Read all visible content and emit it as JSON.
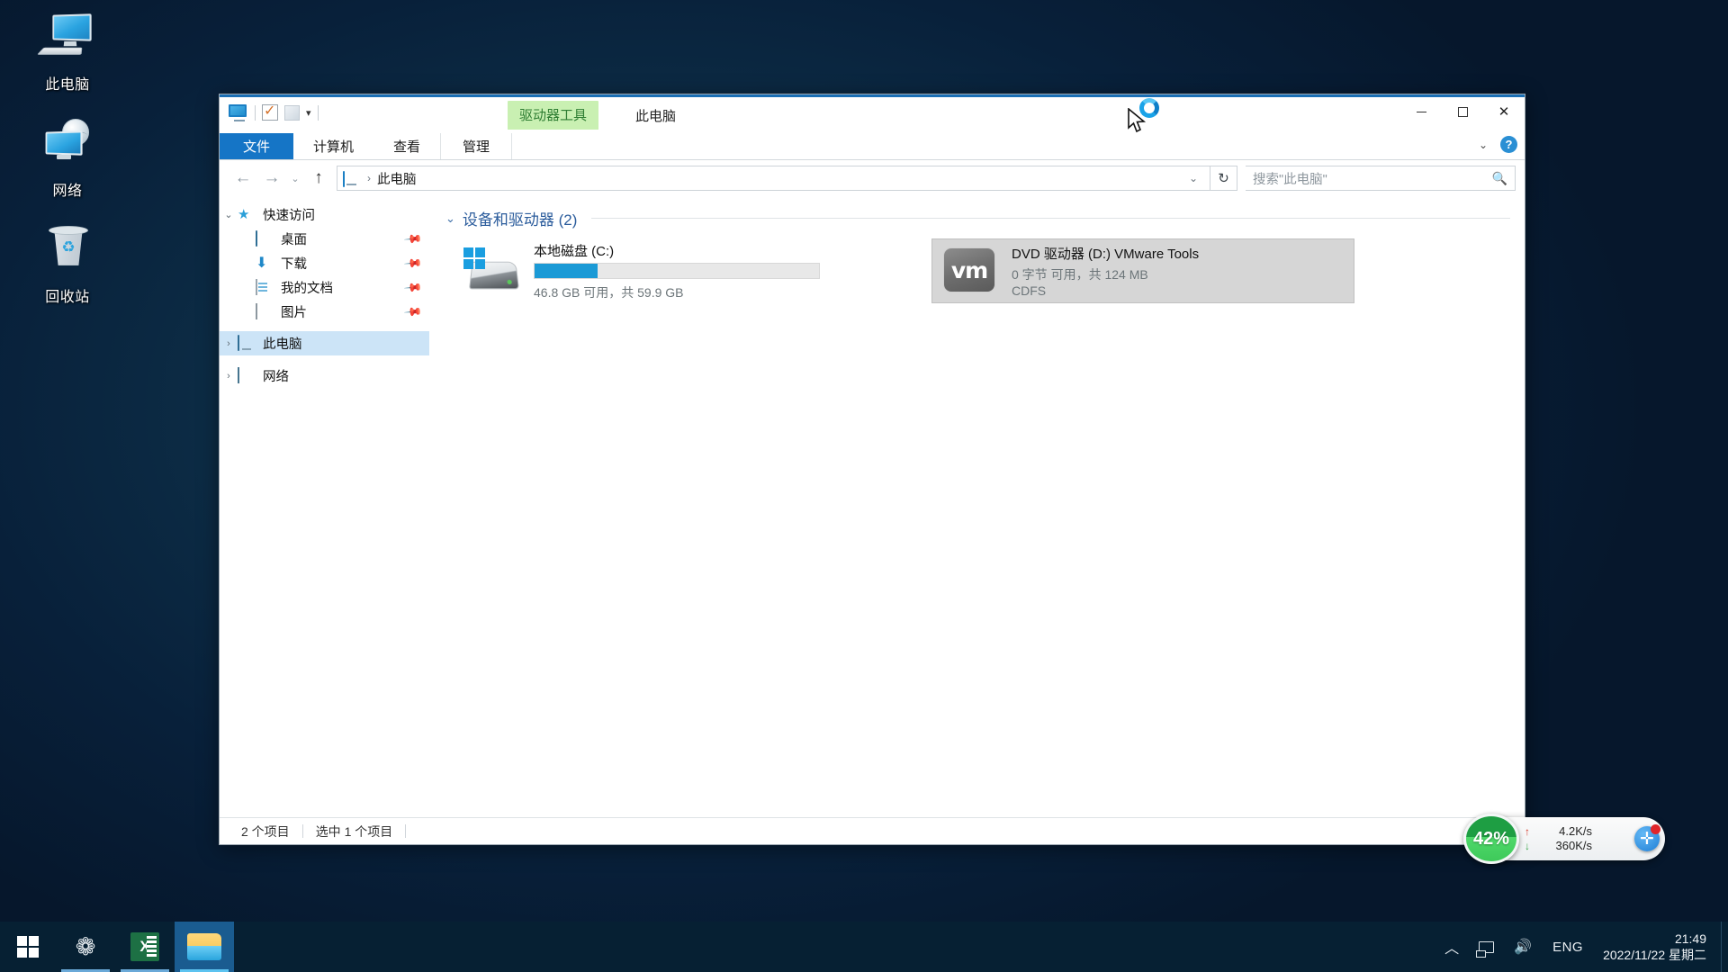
{
  "desktop": {
    "icons": [
      {
        "label": "此电脑",
        "icon": "this-pc-icon"
      },
      {
        "label": "网络",
        "icon": "network-icon"
      },
      {
        "label": "回收站",
        "icon": "recycle-bin-icon"
      }
    ]
  },
  "window": {
    "title": "此电脑",
    "contextual_tab": "驱动器工具",
    "quick_access_toolbar": [
      {
        "name": "this-pc-icon",
        "label": "此电脑"
      },
      {
        "name": "properties-icon",
        "label": "属性"
      },
      {
        "name": "new-folder-icon",
        "label": "新建文件夹"
      },
      {
        "name": "customize-qat-caret",
        "label": "▾"
      }
    ],
    "controls": {
      "minimize": "—",
      "maximize": "□",
      "close": "✕",
      "ribbon_collapse": "⌄",
      "help": "?"
    },
    "ribbon_tabs": [
      {
        "label": "文件",
        "active": true
      },
      {
        "label": "计算机",
        "active": false
      },
      {
        "label": "查看",
        "active": false
      },
      {
        "label": "管理",
        "active": false
      }
    ]
  },
  "addressbar": {
    "back": "←",
    "forward": "→",
    "history": "⌄",
    "up": "↑",
    "crumb_icon": "this-pc-icon",
    "separator": "›",
    "path": "此电脑",
    "dropdown": "⌄",
    "refresh": "↻"
  },
  "search": {
    "placeholder": "搜索\"此电脑\"",
    "icon": "search-icon"
  },
  "navpane": {
    "items": [
      {
        "label": "快速访问",
        "level": 1,
        "expander": "⌄",
        "icon": "pin-star-icon",
        "pinned": false,
        "selected": false
      },
      {
        "label": "桌面",
        "level": 2,
        "expander": "",
        "icon": "desktop-icon",
        "pinned": true,
        "selected": false
      },
      {
        "label": "下载",
        "level": 2,
        "expander": "",
        "icon": "downloads-icon",
        "pinned": true,
        "selected": false
      },
      {
        "label": "我的文档",
        "level": 2,
        "expander": "",
        "icon": "documents-icon",
        "pinned": true,
        "selected": false
      },
      {
        "label": "图片",
        "level": 2,
        "expander": "",
        "icon": "pictures-icon",
        "pinned": true,
        "selected": false
      },
      {
        "label": "此电脑",
        "level": 1,
        "expander": "›",
        "icon": "this-pc-icon",
        "pinned": false,
        "selected": true
      },
      {
        "label": "网络",
        "level": 1,
        "expander": "›",
        "icon": "network-icon",
        "pinned": false,
        "selected": false
      }
    ],
    "pin_glyph": "📌"
  },
  "content": {
    "group": {
      "chevron": "⌄",
      "title": "设备和驱动器 (2)"
    },
    "drives": [
      {
        "name": "本地磁盘 (C:)",
        "free_text": "46.8 GB 可用，共 59.9 GB",
        "fill_percent": 22,
        "bar_color": "#1b9ad6",
        "icon": "hard-drive-windows-icon",
        "selected": false,
        "fs": ""
      },
      {
        "name": "DVD 驱动器 (D:) VMware Tools",
        "free_text": "0 字节 可用，共 124 MB",
        "fs": "CDFS",
        "icon": "vmware-disc-icon",
        "icon_text": "vm",
        "selected": true,
        "fill_percent": 0
      }
    ]
  },
  "statusbar": {
    "item_count": "2 个项目",
    "selection": "选中 1 个项目",
    "views": [
      "details-view-icon",
      "large-icons-view-icon"
    ]
  },
  "netmonitor": {
    "cpu_percent": "42%",
    "up_arrow": "↑",
    "down_arrow": "↓",
    "upload": "4.2K/s",
    "download": "360K/s",
    "badge": "✛"
  },
  "taskbar": {
    "start": "start-button",
    "apps": [
      {
        "name": "ss-app-icon",
        "label": "SS",
        "state": "running"
      },
      {
        "name": "excel-icon",
        "label": "X",
        "state": "running"
      },
      {
        "name": "file-explorer-icon",
        "label": "",
        "state": "active"
      }
    ],
    "tray": {
      "show_hidden": "︿",
      "network_icon": "network-tray-icon",
      "volume_icon": "🔊",
      "language": "ENG",
      "time": "21:49",
      "date": "2022/11/22 星期二"
    }
  },
  "colors": {
    "accent": "#1575c6",
    "drive_bar": "#1b9ad6",
    "contextual_tab_bg": "#c9f0b2",
    "selection": "#cce4f7"
  }
}
